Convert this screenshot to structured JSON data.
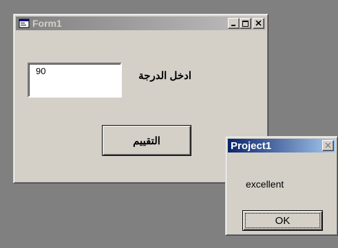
{
  "form1": {
    "title": "Form1",
    "icons": {
      "window_icon": "form-icon",
      "minimize": "minimize-icon",
      "maximize": "maximize-icon",
      "close": "close-icon"
    },
    "textbox_value": "90",
    "label": "ادخل الدرجة",
    "button_label": "التقييم"
  },
  "msgbox": {
    "title": "Project1",
    "message": "excellent",
    "ok_label": "OK",
    "close_icon": "close-icon"
  },
  "colors": {
    "desktop": "#808080",
    "face": "#d4d0c8",
    "inactive_title_start": "#808080",
    "inactive_title_end": "#c0c0c0",
    "active_title_start": "#0a246a",
    "active_title_end": "#a6caf0"
  }
}
